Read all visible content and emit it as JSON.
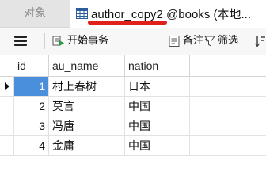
{
  "tabs": {
    "objects_label": "对象",
    "active_table": "author_copy2",
    "active_rest": " @books (本地..."
  },
  "toolbar": {
    "begin_transaction_label": "开始事务",
    "memo_label": "备注",
    "filter_label": "筛选"
  },
  "table": {
    "columns": [
      "id",
      "au_name",
      "nation"
    ],
    "rows": [
      {
        "id": "1",
        "au_name": "村上春树",
        "nation": "日本"
      },
      {
        "id": "2",
        "au_name": "莫言",
        "nation": "中国"
      },
      {
        "id": "3",
        "au_name": "冯唐",
        "nation": "中国"
      },
      {
        "id": "4",
        "au_name": "金庸",
        "nation": "中国"
      }
    ]
  },
  "colors": {
    "selection": "#4a8fdc",
    "underline": "#e0201c"
  }
}
